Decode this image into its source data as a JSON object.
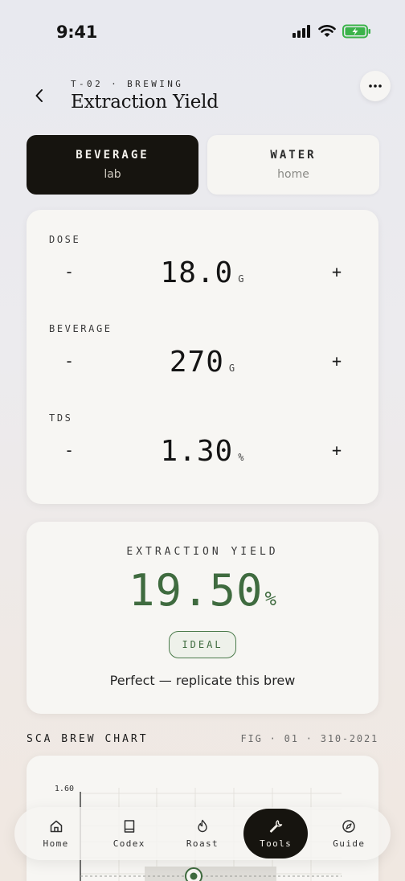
{
  "status": {
    "time": "9:41"
  },
  "header": {
    "eyebrow": "T-02 · BREWING",
    "title": "Extraction Yield"
  },
  "mode": {
    "active": {
      "title": "BEVERAGE",
      "sub": "lab"
    },
    "inactive": {
      "title": "WATER",
      "sub": "home"
    }
  },
  "inputs": [
    {
      "label": "DOSE",
      "value": "18.0",
      "unit": "G"
    },
    {
      "label": "BEVERAGE",
      "value": "270",
      "unit": "G"
    },
    {
      "label": "TDS",
      "value": "1.30",
      "unit": "%"
    }
  ],
  "stepper": {
    "minus": "-",
    "plus": "+"
  },
  "result": {
    "label": "EXTRACTION YIELD",
    "value": "19.50",
    "unit": "%",
    "badge": "IDEAL",
    "message": "Perfect — replicate this brew"
  },
  "chart": {
    "heading": "SCA BREW CHART",
    "fig": "FIG · 01 · 310-2021"
  },
  "chart_data": {
    "type": "scatter",
    "y_ticks": [
      "1.60"
    ],
    "points": [
      {
        "x": 19.5,
        "y": 1.3
      }
    ]
  },
  "nav": [
    {
      "label": "Home",
      "icon": "home-icon"
    },
    {
      "label": "Codex",
      "icon": "book-icon"
    },
    {
      "label": "Roast",
      "icon": "flame-icon"
    },
    {
      "label": "Tools",
      "icon": "wrench-icon",
      "active": true
    },
    {
      "label": "Guide",
      "icon": "compass-icon"
    }
  ],
  "colors": {
    "accent": "#3f6b3f",
    "dark": "#16140f"
  }
}
